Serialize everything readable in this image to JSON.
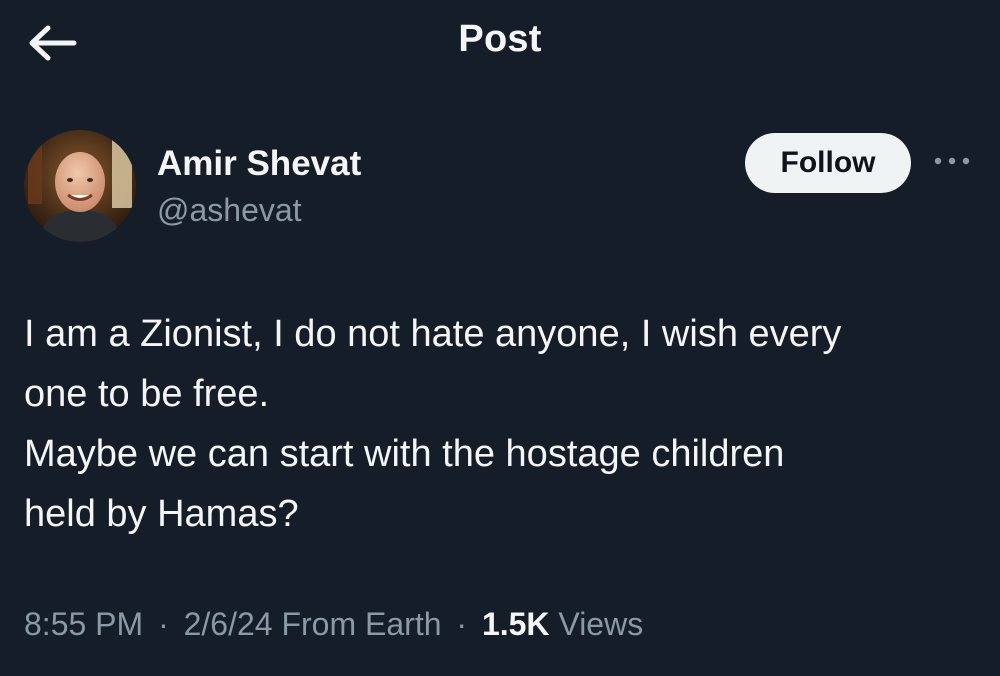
{
  "header": {
    "title": "Post",
    "back_icon": "arrow-left-icon"
  },
  "author": {
    "name": "Amir Shevat",
    "handle": "@ashevat",
    "follow_label": "Follow",
    "more_icon": "more-horizontal-icon"
  },
  "post": {
    "lines": [
      "I am a Zionist, I do not hate anyone, I wish every",
      "one to be free.",
      "Maybe we can start with the hostage children",
      "held by Hamas?"
    ]
  },
  "meta": {
    "time": "8:55 PM",
    "date": "2/6/24",
    "location": "From Earth",
    "views_count": "1.5K",
    "views_label": "Views",
    "separator": "·"
  },
  "colors": {
    "background": "#151d28",
    "text_primary": "#f3f5f6",
    "text_secondary": "#8b98a5",
    "follow_bg": "#eff3f4"
  }
}
